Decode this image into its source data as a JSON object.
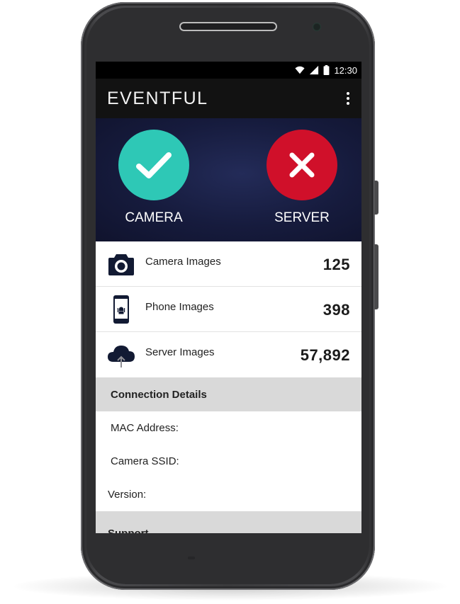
{
  "status_bar": {
    "time": "12:30"
  },
  "app_bar": {
    "title": "EVENTFUL"
  },
  "connection_status": [
    {
      "label": "CAMERA",
      "state": "connected",
      "color": "#2ec8b6",
      "icon": "check-icon"
    },
    {
      "label": "SERVER",
      "state": "disconnected",
      "color": "#d0102a",
      "icon": "close-icon"
    }
  ],
  "stats": [
    {
      "label": "Camera Images",
      "value": "125",
      "icon": "camera-icon"
    },
    {
      "label": "Phone Images",
      "value": "398",
      "icon": "phone-icon"
    },
    {
      "label": "Server Images",
      "value": "57,892",
      "icon": "cloud-upload-icon"
    }
  ],
  "connection_details": {
    "header": "Connection Details",
    "mac_address_label": "MAC Address:",
    "camera_ssid_label": "Camera SSID:",
    "version_label": "Version:"
  },
  "support": {
    "header": "Support"
  },
  "colors": {
    "accent_teal": "#2ec8b6",
    "error_red": "#d0102a",
    "icon_navy": "#121a33"
  }
}
